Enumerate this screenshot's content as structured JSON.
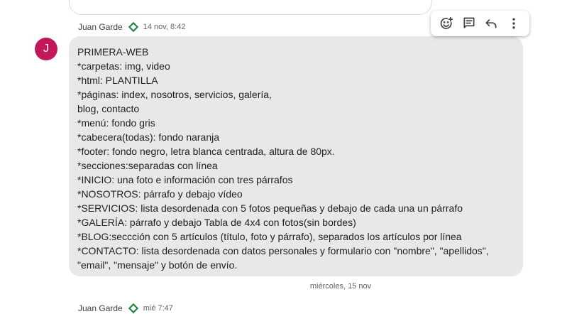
{
  "previous_message": {
    "sender": "Juan Garde",
    "time": "14 nov, 8:42"
  },
  "message": {
    "avatar_initial": "J",
    "avatar_color": "#c2185b",
    "bubble_color": "#e8e8e8",
    "lines": [
      "PRIMERA-WEB",
      "*carpetas: img, video",
      "*html: PLANTILLA",
      "*páginas: index, nosotros, servicios, galería,",
      "blog, contacto",
      "*menú: fondo gris",
      "*cabecera(todas): fondo naranja",
      "*footer: fondo negro, letra blanca centrada, altura de 80px.",
      "*secciones:separadas con línea",
      "*INICIO: una foto e información con tres párrafos",
      "*NOSOTROS: párrafo y debajo vídeo",
      "*SERVICIOS: lista desordenada con 5 fotos pequeñas y debajo de cada una un párrafo",
      "*GALERÍA: párrafo y debajo Tabla de 4x4 con fotos(sin bordes)",
      "*BLOG:seccción con 5 artículos (título, foto y párrafo), separados los artículos por línea",
      "*CONTACTO: lista desordenada con datos personales y formulario con \"nombre\", \"apellidos\",",
      "\"email\", \"mensaje\" y botón de envío."
    ]
  },
  "toolbar": {
    "icons": [
      "add-reaction-icon",
      "reply-in-thread-icon",
      "quote-reply-icon",
      "more-options-icon"
    ]
  },
  "date_divider": "miércoles, 15 nov",
  "next_message": {
    "sender": "Juan Garde",
    "time": "mié 7:47"
  },
  "colors": {
    "verified_diamond": "#188038",
    "meta_text": "#5f6368"
  }
}
